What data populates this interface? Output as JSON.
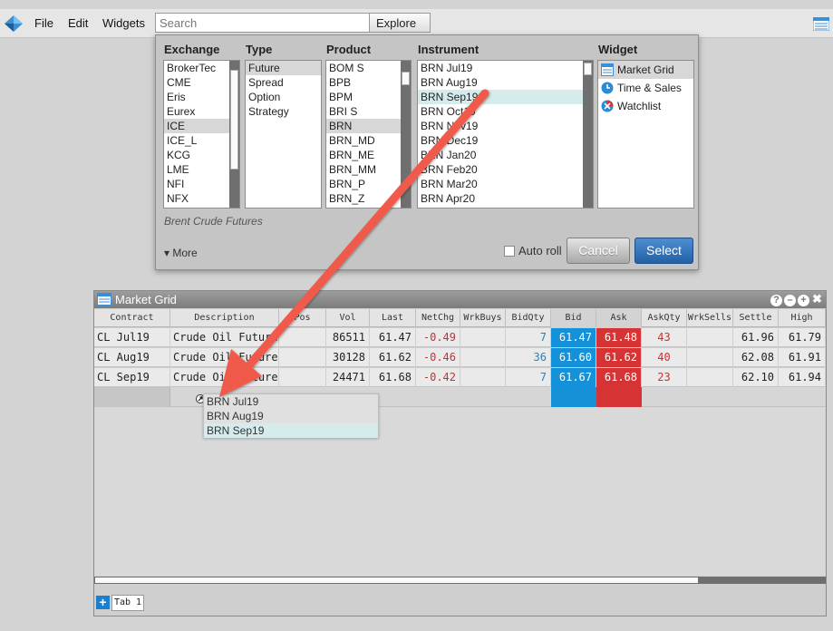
{
  "menubar": {
    "items": [
      "File",
      "Edit",
      "Widgets"
    ],
    "search_placeholder": "Search",
    "explore_label": "Explore ▾"
  },
  "explore": {
    "columns": [
      "Exchange",
      "Type",
      "Product",
      "Instrument",
      "Widget"
    ],
    "exchanges": [
      "BrokerTec",
      "CME",
      "Eris",
      "Eurex",
      "ICE",
      "ICE_L",
      "KCG",
      "LME",
      "NFI",
      "NFX"
    ],
    "selected_exchange": "ICE",
    "types": [
      "Future",
      "Spread",
      "Option",
      "Strategy"
    ],
    "selected_type": "Future",
    "products": [
      "BOM S",
      "BPB",
      "BPM",
      "BRI S",
      "BRN",
      "BRN_MD",
      "BRN_ME",
      "BRN_MM",
      "BRN_P",
      "BRN_Z"
    ],
    "selected_product": "BRN",
    "instruments": [
      "BRN Jul19",
      "BRN Aug19",
      "BRN Sep19",
      "BRN Oct19",
      "BRN Nov19",
      "BRN Dec19",
      "BRN Jan20",
      "BRN Feb20",
      "BRN Mar20",
      "BRN Apr20"
    ],
    "highlighted_instrument": "BRN Sep19",
    "widgets": [
      "Market Grid",
      "Time & Sales",
      "Watchlist"
    ],
    "selected_widget": "Market Grid",
    "description": "Brent Crude Futures",
    "more_label": "▾ More",
    "autoroll_label": "Auto roll",
    "autoroll_checked": false,
    "cancel_label": "Cancel",
    "select_label": "Select"
  },
  "market_grid": {
    "title": "Market Grid",
    "columns": [
      "Contract",
      "Description",
      "Pos",
      "Vol",
      "Last",
      "NetChg",
      "WrkBuys",
      "BidQty",
      "Bid",
      "Ask",
      "AskQty",
      "WrkSells",
      "Settle",
      "High"
    ],
    "rows": [
      {
        "contract": "CL Jul19",
        "description": "Crude Oil Futures",
        "pos": "",
        "vol": "86511",
        "last": "61.47",
        "netchg": "-0.49",
        "wrkbuys": "",
        "bidqty": "7",
        "bid": "61.47",
        "ask": "61.48",
        "askqty": "43",
        "wrksells": "",
        "settle": "61.96",
        "high": "61.79"
      },
      {
        "contract": "CL Aug19",
        "description": "Crude Oil Futures",
        "pos": "",
        "vol": "30128",
        "last": "61.62",
        "netchg": "-0.46",
        "wrkbuys": "",
        "bidqty": "36",
        "bid": "61.60",
        "ask": "61.62",
        "askqty": "40",
        "wrksells": "",
        "settle": "62.08",
        "high": "61.91"
      },
      {
        "contract": "CL Sep19",
        "description": "Crude Oil Futures",
        "pos": "",
        "vol": "24471",
        "last": "61.68",
        "netchg": "-0.42",
        "wrkbuys": "",
        "bidqty": "7",
        "bid": "61.67",
        "ask": "61.68",
        "askqty": "23",
        "wrksells": "",
        "settle": "62.10",
        "high": "61.94"
      }
    ],
    "tab_label": "Tab 1",
    "add_tab_label": "+"
  },
  "dropdown": {
    "items": [
      "BRN Jul19",
      "BRN Aug19",
      "BRN Sep19"
    ],
    "highlighted": "BRN Sep19"
  },
  "colors": {
    "bid": "#1491d9",
    "ask": "#d63334",
    "select": "#2a6bb3",
    "arrow": "#ef5a4c",
    "highlight": "#d6ebec"
  }
}
